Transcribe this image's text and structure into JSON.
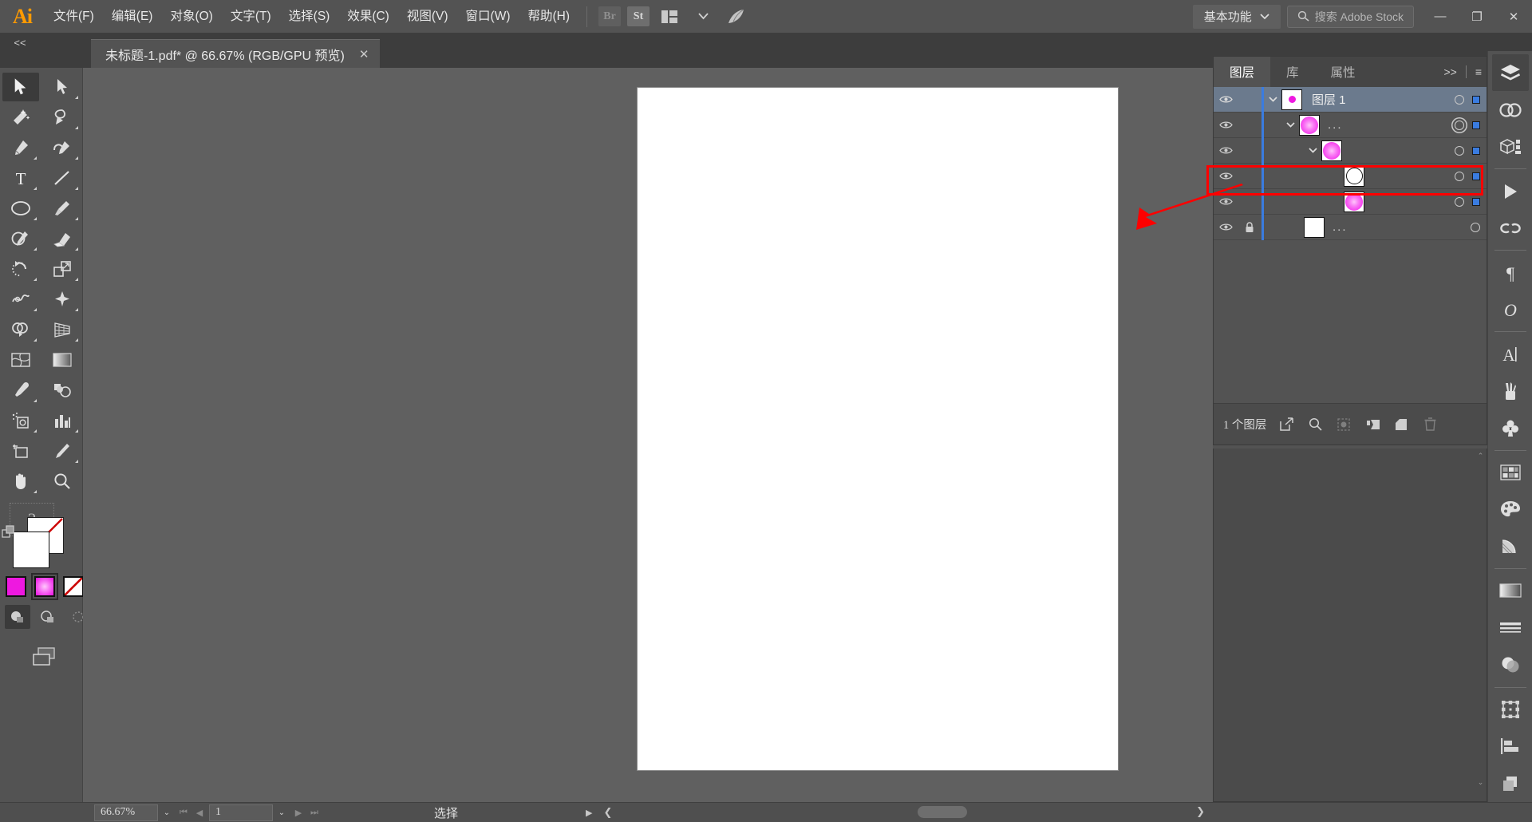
{
  "app": {
    "name": "Adobe Illustrator",
    "logo_text": "Ai"
  },
  "menubar": {
    "items": [
      {
        "label": "文件(F)",
        "name": "menu-file"
      },
      {
        "label": "编辑(E)",
        "name": "menu-edit"
      },
      {
        "label": "对象(O)",
        "name": "menu-object"
      },
      {
        "label": "文字(T)",
        "name": "menu-type"
      },
      {
        "label": "选择(S)",
        "name": "menu-select"
      },
      {
        "label": "效果(C)",
        "name": "menu-effect"
      },
      {
        "label": "视图(V)",
        "name": "menu-view"
      },
      {
        "label": "窗口(W)",
        "name": "menu-window"
      },
      {
        "label": "帮助(H)",
        "name": "menu-help"
      }
    ],
    "bridge_label": "Br",
    "stock_label": "St",
    "arrange_icon": "arrange-documents-icon",
    "chevron": "⌄",
    "home_icon": "illustrator-home-icon",
    "workspace": "基本功能",
    "workspace_caret": "⌄",
    "search_placeholder": "搜索 Adobe Stock",
    "search_icon": "search-icon",
    "window_minimize": "—",
    "window_restore": "❐",
    "window_close": "✕"
  },
  "tabbar": {
    "collapse_icon": "<<",
    "document_title": "未标题-1.pdf* @ 66.67% (RGB/GPU 预览)",
    "close_icon": "✕"
  },
  "toolbar": {
    "tools": [
      {
        "name": "selection-tool",
        "title": "选择工具",
        "active": true
      },
      {
        "name": "direct-selection-tool",
        "title": "直接选择工具",
        "active": false
      },
      {
        "name": "magic-wand-tool",
        "title": "魔棒工具",
        "active": false
      },
      {
        "name": "lasso-tool",
        "title": "套索工具",
        "active": false
      },
      {
        "name": "pen-tool",
        "title": "钢笔工具",
        "active": false
      },
      {
        "name": "curvature-tool",
        "title": "曲率工具",
        "active": false
      },
      {
        "name": "type-tool",
        "title": "文字工具",
        "active": false
      },
      {
        "name": "line-segment-tool",
        "title": "直线段工具",
        "active": false
      },
      {
        "name": "ellipse-tool",
        "title": "椭圆工具",
        "active": false
      },
      {
        "name": "paintbrush-tool",
        "title": "画笔工具",
        "active": false
      },
      {
        "name": "shaper-tool",
        "title": "Shaper 工具",
        "active": false
      },
      {
        "name": "eraser-tool",
        "title": "橡皮擦工具",
        "active": false
      },
      {
        "name": "rotate-tool",
        "title": "旋转工具",
        "active": false
      },
      {
        "name": "scale-tool",
        "title": "比例缩放工具",
        "active": false
      },
      {
        "name": "width-tool",
        "title": "宽度工具",
        "active": false
      },
      {
        "name": "free-transform-tool",
        "title": "自由变换工具",
        "active": false
      },
      {
        "name": "shape-builder-tool",
        "title": "形状生成器工具",
        "active": false
      },
      {
        "name": "perspective-grid-tool",
        "title": "透视网格工具",
        "active": false
      },
      {
        "name": "mesh-tool",
        "title": "网格工具",
        "active": false
      },
      {
        "name": "gradient-tool",
        "title": "渐变工具",
        "active": false
      },
      {
        "name": "eyedropper-tool",
        "title": "吸管工具",
        "active": false
      },
      {
        "name": "blend-tool",
        "title": "混合工具",
        "active": false
      },
      {
        "name": "symbol-sprayer-tool",
        "title": "符号喷枪工具",
        "active": false
      },
      {
        "name": "column-graph-tool",
        "title": "柱形图工具",
        "active": false
      },
      {
        "name": "artboard-tool",
        "title": "画板工具",
        "active": false
      },
      {
        "name": "slice-tool",
        "title": "切片工具",
        "active": false
      },
      {
        "name": "hand-tool",
        "title": "抓手工具",
        "active": false
      },
      {
        "name": "zoom-tool",
        "title": "缩放工具",
        "active": false
      }
    ],
    "help_icon": "?",
    "swap-fill-stroke": "swap-fill-stroke-icon",
    "fill_color": "#ffffff",
    "stroke_color": "none",
    "mini_swatches": [
      {
        "name": "color-swatch",
        "color": "#ee18e0"
      },
      {
        "name": "gradient-swatch",
        "color": "gradient"
      },
      {
        "name": "none-swatch",
        "color": "none"
      }
    ],
    "screen_mode_icon": "change-screen-mode-icon"
  },
  "canvas": {
    "artboard_color": "#ffffff",
    "shape": {
      "name": "radial-gradient-ellipse",
      "fill_center": "#ffb3f7",
      "fill_edge": "#ea0ce4",
      "selected": true
    },
    "selection_color": "#4a90d9"
  },
  "panels": {
    "tabs": [
      {
        "label": "图层",
        "name": "tab-layers",
        "active": true
      },
      {
        "label": "库",
        "name": "tab-libraries",
        "active": false
      },
      {
        "label": "属性",
        "name": "tab-properties",
        "active": false
      }
    ],
    "expand_icon": ">>",
    "menu_icon": "≡",
    "layers": [
      {
        "name": "图层 1",
        "indent": 0,
        "visible": true,
        "locked": false,
        "expandable": true,
        "expanded": true,
        "thumb": "dot",
        "selected": true,
        "target_double": false,
        "has_select_square": true
      },
      {
        "name": "...",
        "indent": 1,
        "visible": true,
        "locked": false,
        "expandable": true,
        "expanded": true,
        "thumb": "ball",
        "selected": false,
        "target_double": true,
        "has_select_square": true
      },
      {
        "name": "",
        "indent": 2,
        "visible": true,
        "locked": false,
        "expandable": true,
        "expanded": true,
        "thumb": "ball",
        "selected": false,
        "target_double": false,
        "has_select_square": true
      },
      {
        "name": "",
        "indent": 3,
        "visible": true,
        "locked": false,
        "expandable": false,
        "expanded": false,
        "thumb": "white-circle",
        "selected": false,
        "target_double": false,
        "has_select_square": true,
        "highlighted": true
      },
      {
        "name": "",
        "indent": 3,
        "visible": true,
        "locked": false,
        "expandable": false,
        "expanded": false,
        "thumb": "ball",
        "selected": false,
        "target_double": false,
        "has_select_square": true
      },
      {
        "name": "...",
        "indent": 1,
        "visible": true,
        "locked": true,
        "expandable": false,
        "expanded": false,
        "thumb": "white",
        "selected": false,
        "target_double": false,
        "has_select_square": false
      }
    ],
    "footer": {
      "count_text": "1 个图层",
      "icons": [
        {
          "name": "release-to-layers-icon",
          "glyph": "release",
          "dim": false
        },
        {
          "name": "locate-object-icon",
          "glyph": "search",
          "dim": false
        },
        {
          "name": "make-clipping-mask-icon",
          "glyph": "mask",
          "dim": true
        },
        {
          "name": "create-new-sublayer-icon",
          "glyph": "sublayer",
          "dim": false
        },
        {
          "name": "create-new-layer-icon",
          "glyph": "newlayer",
          "dim": false
        },
        {
          "name": "delete-selection-icon",
          "glyph": "trash",
          "dim": true
        }
      ]
    }
  },
  "rail": {
    "groups": [
      [
        {
          "name": "layers-rail-icon",
          "glyph": "layers",
          "active": true
        },
        {
          "name": "creative-cloud-libraries-rail-icon",
          "glyph": "cc",
          "active": false
        },
        {
          "name": "asset-export-rail-icon",
          "glyph": "assets",
          "active": false
        }
      ],
      [
        {
          "name": "actions-rail-icon",
          "glyph": "play",
          "active": false
        },
        {
          "name": "links-rail-icon",
          "glyph": "link",
          "active": false
        }
      ],
      [
        {
          "name": "paragraph-rail-icon",
          "glyph": "pilcrow",
          "active": false
        },
        {
          "name": "character-rail-icon",
          "glyph": "italic-o",
          "active": false
        }
      ],
      [
        {
          "name": "glyphs-rail-icon",
          "glyph": "A",
          "active": false
        },
        {
          "name": "brushes-rail-icon",
          "glyph": "brushes",
          "active": false
        },
        {
          "name": "symbols-rail-icon",
          "glyph": "club",
          "active": false
        }
      ],
      [
        {
          "name": "swatches-rail-icon",
          "glyph": "swatches",
          "active": false
        },
        {
          "name": "color-rail-icon",
          "glyph": "palette",
          "active": false
        },
        {
          "name": "color-guide-rail-icon",
          "glyph": "guide",
          "active": false
        }
      ],
      [
        {
          "name": "gradient-rail-icon",
          "glyph": "gradient",
          "active": false
        },
        {
          "name": "stroke-rail-icon",
          "glyph": "stroke",
          "active": false
        },
        {
          "name": "transparency-rail-icon",
          "glyph": "transparency",
          "active": false
        }
      ],
      [
        {
          "name": "transform-rail-icon",
          "glyph": "transform",
          "active": false
        },
        {
          "name": "align-rail-icon",
          "glyph": "align",
          "active": false
        },
        {
          "name": "pathfinder-rail-icon",
          "glyph": "pathfinder",
          "active": false
        }
      ]
    ]
  },
  "statusbar": {
    "zoom_value": "66.67%",
    "zoom_caret": "⌄",
    "nav_first": "⏮",
    "nav_prev": "◀",
    "page_value": "1",
    "page_caret": "⌄",
    "nav_next": "▶",
    "nav_last": "⏭",
    "current_tool": "选择",
    "status_arrow": "▶",
    "status_chevron": "❮",
    "scroll_chevron": "❯"
  },
  "annotation": {
    "rect_color": "#fe0000",
    "arrow_color": "#fe0000"
  }
}
